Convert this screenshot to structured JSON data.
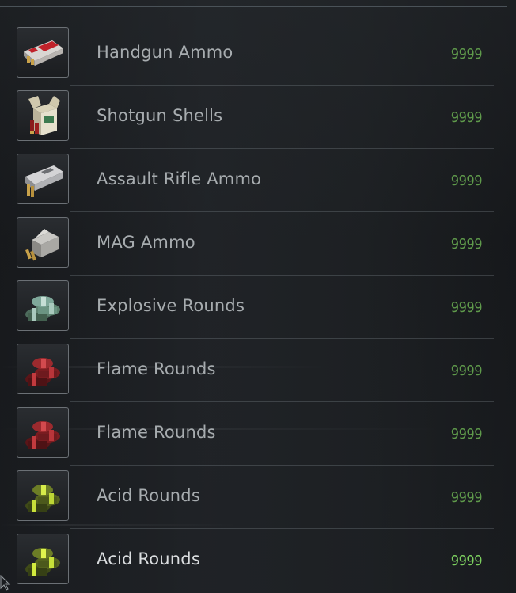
{
  "items": [
    {
      "name": "Handgun Ammo",
      "count": "9999",
      "icon": "handgun-ammo-box-icon"
    },
    {
      "name": "Shotgun Shells",
      "count": "9999",
      "icon": "shotgun-shells-box-icon"
    },
    {
      "name": "Assault Rifle Ammo",
      "count": "9999",
      "icon": "assault-rifle-ammo-box-icon"
    },
    {
      "name": "MAG Ammo",
      "count": "9999",
      "icon": "mag-ammo-box-icon"
    },
    {
      "name": "Explosive Rounds",
      "count": "9999",
      "icon": "explosive-rounds-icon"
    },
    {
      "name": "Flame Rounds",
      "count": "9999",
      "icon": "flame-rounds-icon"
    },
    {
      "name": "Flame Rounds",
      "count": "9999",
      "icon": "flame-rounds-icon"
    },
    {
      "name": "Acid Rounds",
      "count": "9999",
      "icon": "acid-rounds-icon"
    },
    {
      "name": "Acid Rounds",
      "count": "9999",
      "icon": "acid-rounds-icon",
      "selected": true
    }
  ],
  "colors": {
    "count_text": "#5f9a4b",
    "count_text_selected": "#7ccf5f",
    "name_text": "#a7acaf",
    "name_text_selected": "#dadddf",
    "background": "#1b1d20"
  }
}
